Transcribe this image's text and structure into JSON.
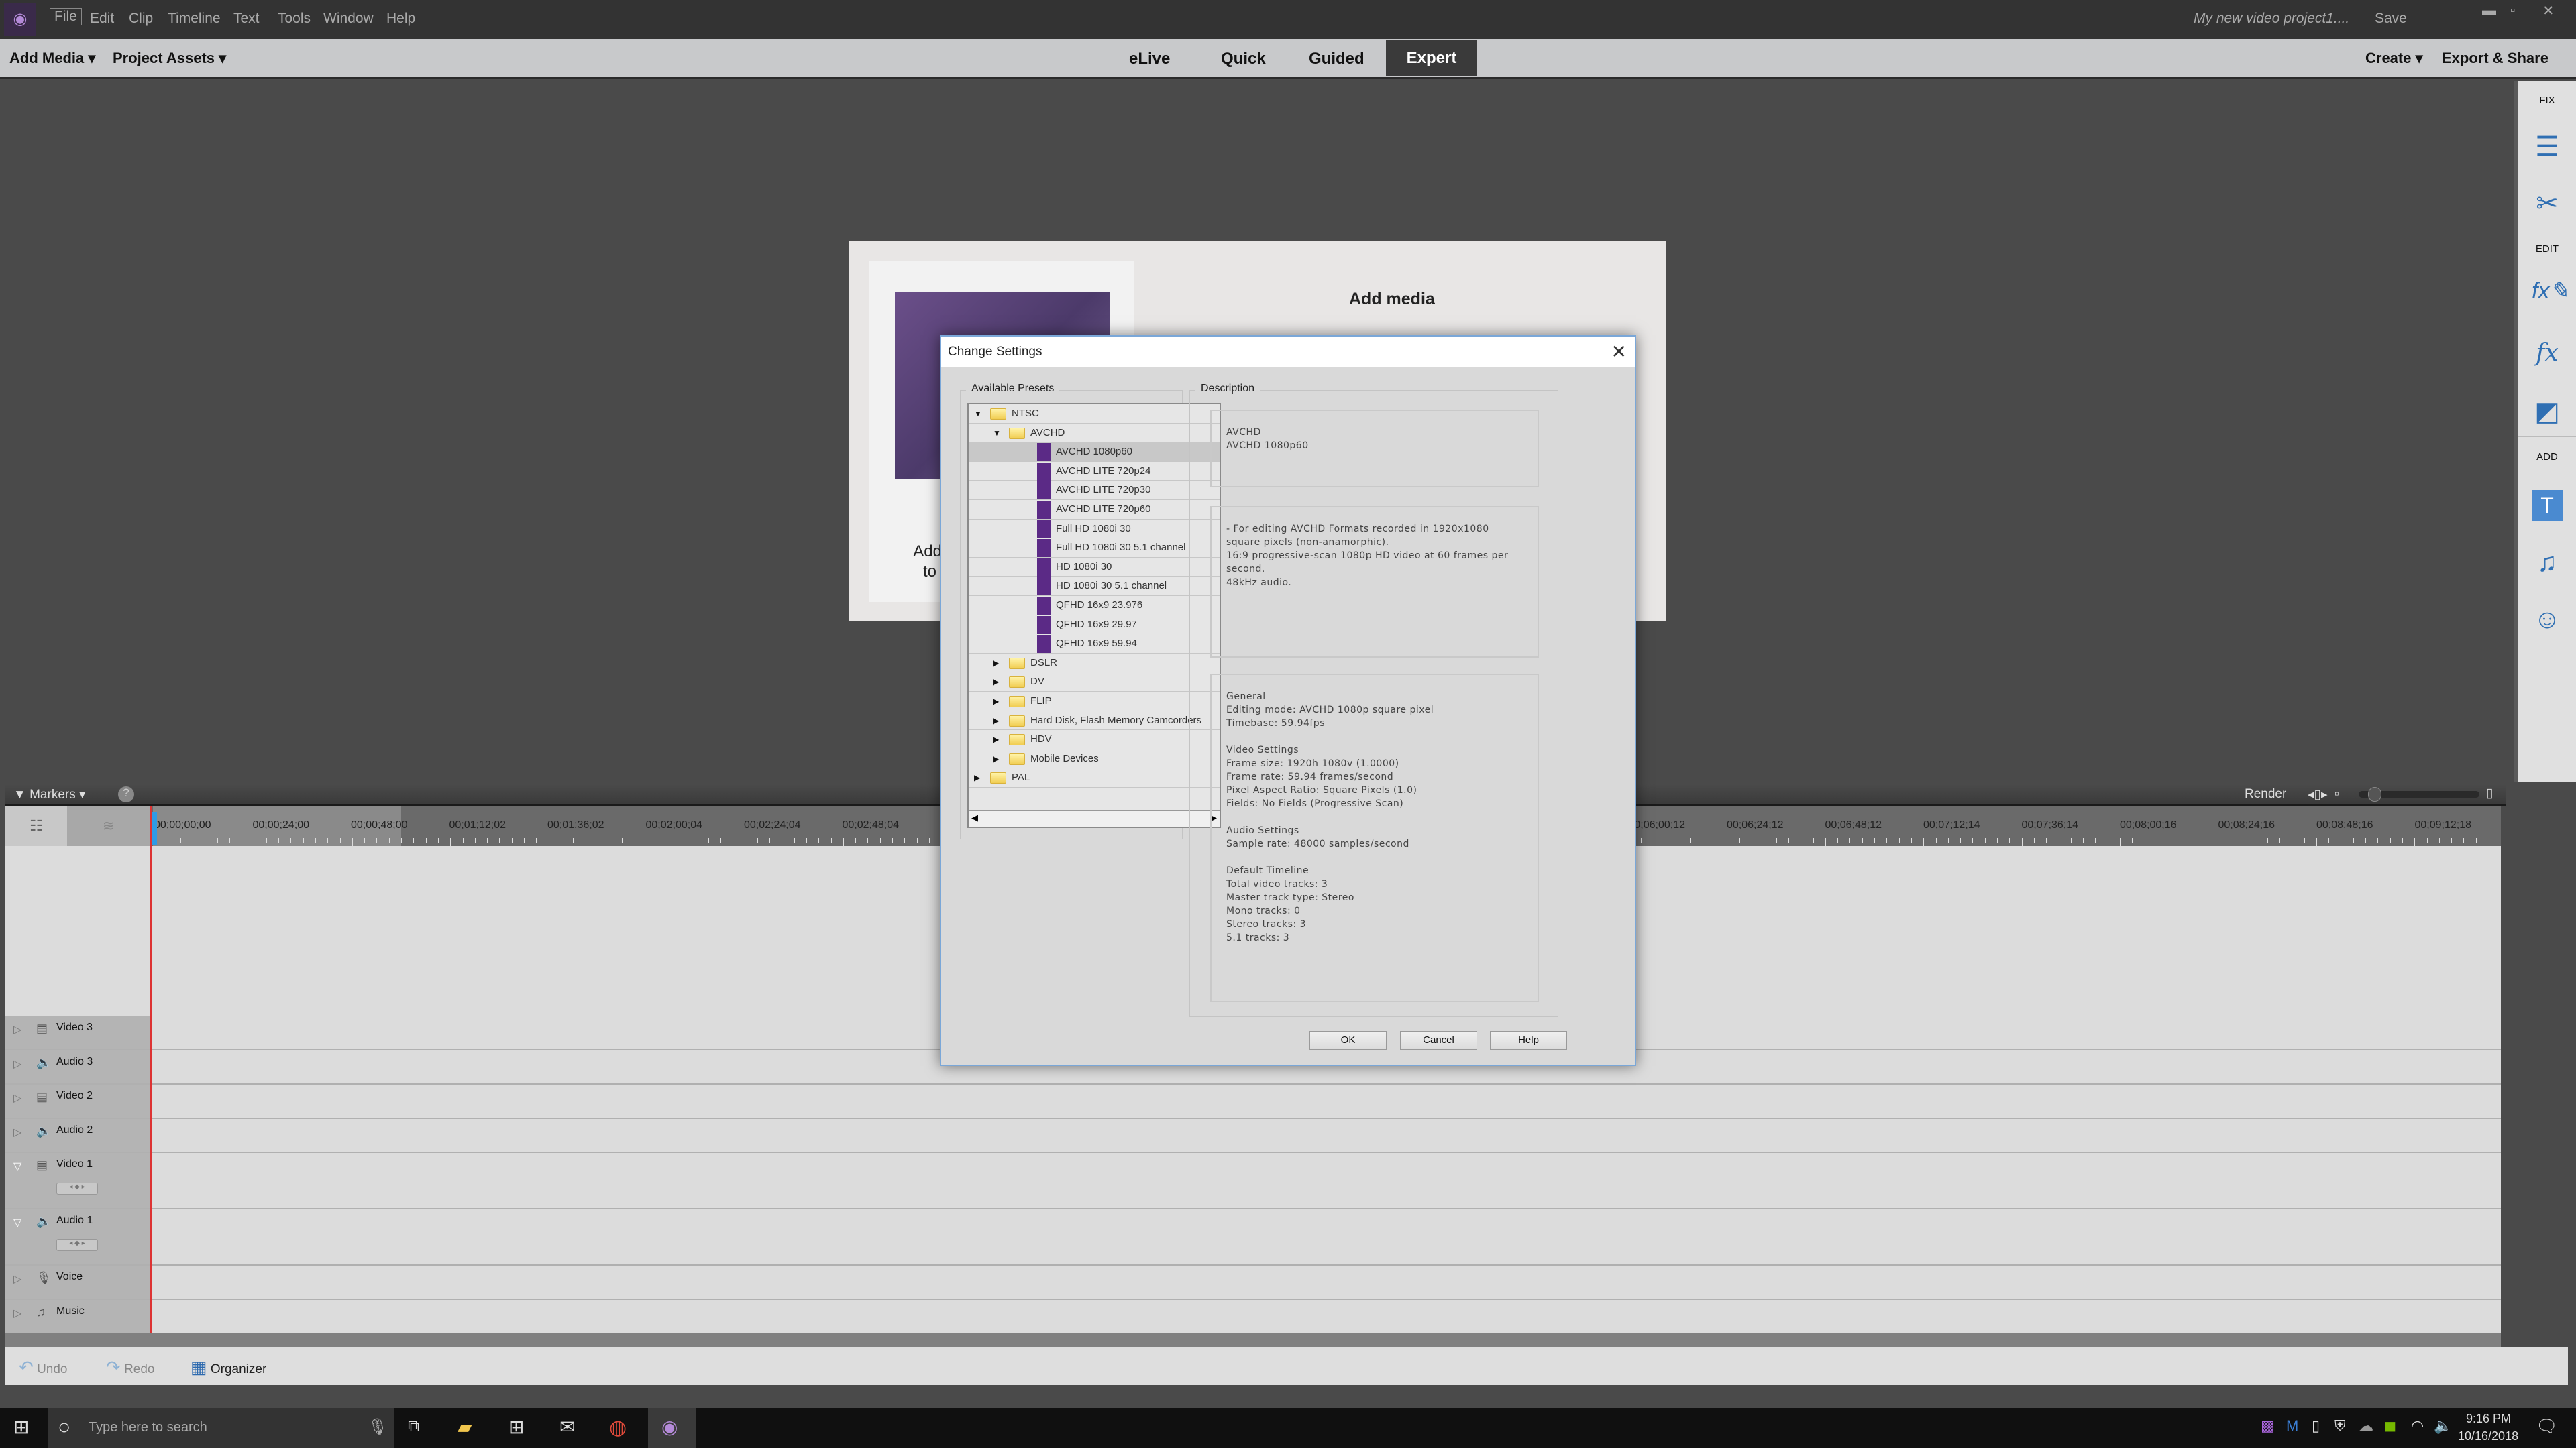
{
  "app": {
    "menu": [
      "File",
      "Edit",
      "Clip",
      "Timeline",
      "Text",
      "Tools",
      "Window",
      "Help"
    ],
    "project_name": "My new video project1....",
    "save_label": "Save"
  },
  "toolbar": {
    "add_media": "Add Media",
    "project_assets": "Project Assets",
    "tabs": [
      "eLive",
      "Quick",
      "Guided",
      "Expert"
    ],
    "active_tab": "Expert",
    "create": "Create",
    "export_share": "Export & Share"
  },
  "right_panel": {
    "fix": "FIX",
    "edit": "EDIT",
    "add": "ADD",
    "icons": [
      "adjust-sliders-icon",
      "tools-icon",
      "fx-edit-icon",
      "fx-icon",
      "transition-icon",
      "title-text-icon",
      "music-note-icon",
      "graphics-smiley-icon"
    ],
    "accent": "#2f6fb3"
  },
  "add_media_panel": {
    "title": "Add media",
    "text_line1": "Add aud",
    "text_line2": "to get"
  },
  "dialog": {
    "title": "Change Settings",
    "presets_label": "Available Presets",
    "description_label": "Description",
    "tree": [
      {
        "label": "NTSC",
        "type": "folder",
        "level": 0,
        "expanded": true
      },
      {
        "label": "AVCHD",
        "type": "folder",
        "level": 1,
        "expanded": true
      },
      {
        "label": "AVCHD 1080p60",
        "type": "preset",
        "level": 2,
        "selected": true
      },
      {
        "label": "AVCHD LITE 720p24",
        "type": "preset",
        "level": 2
      },
      {
        "label": "AVCHD LITE 720p30",
        "type": "preset",
        "level": 2
      },
      {
        "label": "AVCHD LITE 720p60",
        "type": "preset",
        "level": 2
      },
      {
        "label": "Full HD 1080i 30",
        "type": "preset",
        "level": 2
      },
      {
        "label": "Full HD 1080i 30 5.1 channel",
        "type": "preset",
        "level": 2
      },
      {
        "label": "HD 1080i 30",
        "type": "preset",
        "level": 2
      },
      {
        "label": "HD 1080i 30 5.1 channel",
        "type": "preset",
        "level": 2
      },
      {
        "label": "QFHD 16x9 23.976",
        "type": "preset",
        "level": 2
      },
      {
        "label": "QFHD 16x9 29.97",
        "type": "preset",
        "level": 2
      },
      {
        "label": "QFHD 16x9 59.94",
        "type": "preset",
        "level": 2
      },
      {
        "label": "DSLR",
        "type": "folder",
        "level": 1,
        "expanded": false
      },
      {
        "label": "DV",
        "type": "folder",
        "level": 1,
        "expanded": false
      },
      {
        "label": "FLIP",
        "type": "folder",
        "level": 1,
        "expanded": false
      },
      {
        "label": "Hard Disk, Flash Memory Camcorders",
        "type": "folder",
        "level": 1,
        "expanded": false
      },
      {
        "label": "HDV",
        "type": "folder",
        "level": 1,
        "expanded": false
      },
      {
        "label": "Mobile Devices",
        "type": "folder",
        "level": 1,
        "expanded": false
      },
      {
        "label": "PAL",
        "type": "folder",
        "level": 0,
        "expanded": false
      }
    ],
    "desc_name": "AVCHD\nAVCHD 1080p60",
    "desc_summary": "- For editing AVCHD Formats recorded in 1920x1080\nsquare pixels (non-anamorphic).\n16:9 progressive-scan 1080p HD video at 60 frames per\nsecond.\n48kHz audio.",
    "desc_details": "General\n Editing mode: AVCHD 1080p square pixel\n Timebase: 59.94fps\n\nVideo Settings\n Frame size: 1920h 1080v (1.0000)\n Frame rate: 59.94 frames/second\n Pixel Aspect Ratio: Square Pixels (1.0)\n Fields: No Fields (Progressive Scan)\n\nAudio Settings\n Sample rate: 48000 samples/second\n\nDefault Timeline\n Total video tracks: 3\n Master track type: Stereo\n Mono tracks: 0\n Stereo tracks: 3\n 5.1 tracks: 3",
    "ok": "OK",
    "cancel": "Cancel",
    "help": "Help"
  },
  "timeline": {
    "markers": "Markers",
    "render": "Render",
    "ruler_left": [
      "00;00;00;00",
      "00;00;24;00",
      "00;00;48;00",
      "00;01;12;02",
      "00;01;36;02",
      "00;02;00;04",
      "00;02;24;04",
      "00;02;48;04"
    ],
    "ruler_right": [
      "00;06;00;12",
      "00;06;24;12",
      "00;06;48;12",
      "00;07;12;14",
      "00;07;36;14",
      "00;08;00;16",
      "00;08;24;16",
      "00;08;48;16",
      "00;09;12;18"
    ],
    "tracks": [
      {
        "name": "Video 3",
        "icon": "film-icon",
        "expanded": false
      },
      {
        "name": "Audio 3",
        "icon": "speaker-icon",
        "expanded": false
      },
      {
        "name": "Video 2",
        "icon": "film-icon",
        "expanded": false
      },
      {
        "name": "Audio 2",
        "icon": "speaker-icon",
        "expanded": false
      },
      {
        "name": "Video 1",
        "icon": "film-icon",
        "expanded": true
      },
      {
        "name": "Audio 1",
        "icon": "speaker-icon",
        "expanded": true
      },
      {
        "name": "Voice",
        "icon": "microphone-icon",
        "expanded": false
      },
      {
        "name": "Music",
        "icon": "music-note-icon",
        "expanded": false
      }
    ]
  },
  "bottom": {
    "undo": "Undo",
    "redo": "Redo",
    "organizer": "Organizer"
  },
  "taskbar": {
    "search_placeholder": "Type here to search",
    "time": "9:16 PM",
    "date": "10/16/2018"
  }
}
